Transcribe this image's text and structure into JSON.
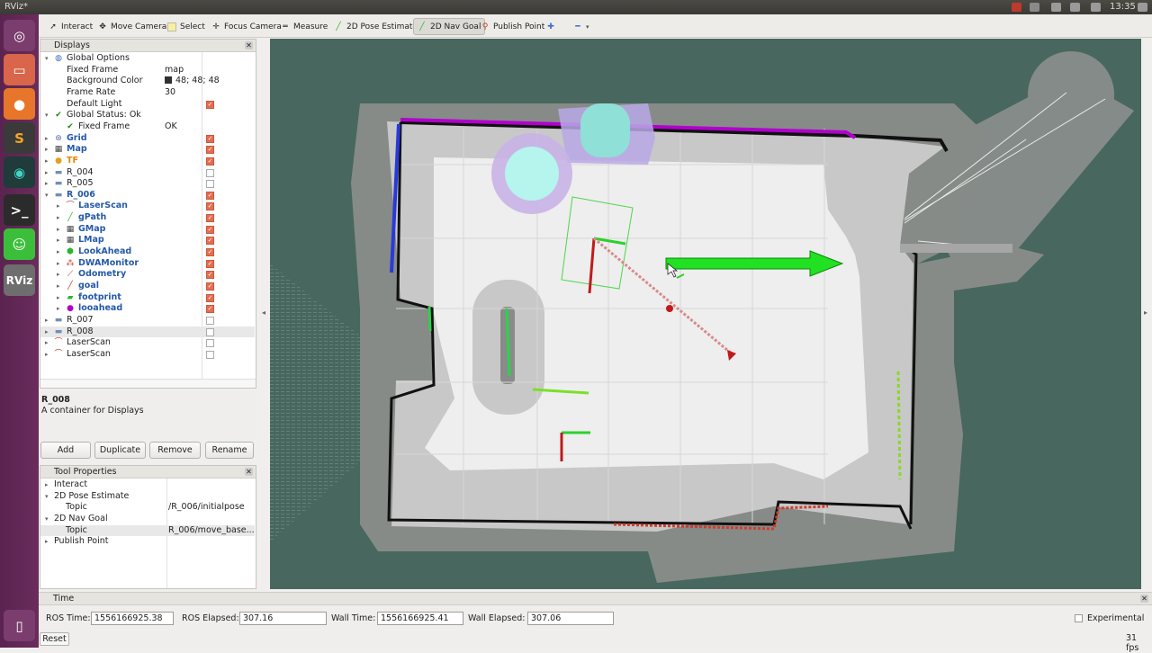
{
  "window": {
    "title": "RViz*",
    "clock": "13:35",
    "fps": "31 fps"
  },
  "launcher": [
    "ubuntu-icon",
    "files-icon",
    "firefox-icon",
    "sublime-icon",
    "gitkraken-icon",
    "terminal-icon",
    "runner-icon",
    "rviz-icon",
    "trash-icon"
  ],
  "toolbar": {
    "tools": [
      {
        "label": "Interact",
        "icon": "cursor-icon"
      },
      {
        "label": "Move Camera",
        "icon": "move-camera-icon"
      },
      {
        "label": "Select",
        "icon": "select-icon"
      },
      {
        "label": "Focus Camera",
        "icon": "focus-camera-icon"
      },
      {
        "label": "Measure",
        "icon": "ruler-icon"
      },
      {
        "label": "2D Pose Estimate",
        "icon": "green-arrow-icon"
      },
      {
        "label": "2D Nav Goal",
        "icon": "green-arrow-icon"
      },
      {
        "label": "Publish Point",
        "icon": "map-pin-icon"
      }
    ],
    "active_tool": "2D Nav Goal"
  },
  "displays": {
    "header": "Displays",
    "rows": [
      {
        "label": "Global Options",
        "indent": 1,
        "expand": "▾",
        "icon": "globe"
      },
      {
        "label": "Fixed Frame",
        "indent": 2,
        "value": "map"
      },
      {
        "label": "Background Color",
        "indent": 2,
        "value": "48; 48; 48",
        "swatch": "#303030"
      },
      {
        "label": "Frame Rate",
        "indent": 2,
        "value": "30"
      },
      {
        "label": "Default Light",
        "indent": 2,
        "check": true
      },
      {
        "label": "Global Status: Ok",
        "indent": 1,
        "expand": "▾",
        "icon": "check"
      },
      {
        "label": "Fixed Frame",
        "indent": 2,
        "icon": "check",
        "value": "OK"
      },
      {
        "label": "Grid",
        "indent": 1,
        "expand": "▸",
        "icon": "grid",
        "style": "blue",
        "check": true
      },
      {
        "label": "Map",
        "indent": 1,
        "expand": "▸",
        "icon": "map",
        "style": "blue",
        "check": true
      },
      {
        "label": "TF",
        "indent": 1,
        "expand": "▸",
        "icon": "tf",
        "style": "orange",
        "check": true
      },
      {
        "label": "R_004",
        "indent": 1,
        "expand": "▸",
        "icon": "folder",
        "check": false
      },
      {
        "label": "R_005",
        "indent": 1,
        "expand": "▸",
        "icon": "folder",
        "check": false
      },
      {
        "label": "R_006",
        "indent": 1,
        "expand": "▾",
        "icon": "folder",
        "style": "blue",
        "check": true
      },
      {
        "label": "LaserScan",
        "indent": 2,
        "expand": "▸",
        "icon": "laser",
        "style": "blue",
        "check": true
      },
      {
        "label": "gPath",
        "indent": 2,
        "expand": "▸",
        "icon": "path",
        "style": "blue",
        "check": true
      },
      {
        "label": "GMap",
        "indent": 2,
        "expand": "▸",
        "icon": "map",
        "style": "blue",
        "check": true
      },
      {
        "label": "LMap",
        "indent": 2,
        "expand": "▸",
        "icon": "map",
        "style": "blue",
        "check": true
      },
      {
        "label": "LookAhead",
        "indent": 2,
        "expand": "▸",
        "icon": "shield",
        "style": "blue",
        "check": true
      },
      {
        "label": "DWAMonitor",
        "indent": 2,
        "expand": "▸",
        "icon": "markers",
        "style": "blue",
        "check": true
      },
      {
        "label": "Odometry",
        "indent": 2,
        "expand": "▸",
        "icon": "odom",
        "style": "blue",
        "check": true
      },
      {
        "label": "goal",
        "indent": 2,
        "expand": "▸",
        "icon": "pose",
        "style": "blue",
        "check": true
      },
      {
        "label": "footprint",
        "indent": 2,
        "expand": "▸",
        "icon": "polygon",
        "style": "blue",
        "check": true
      },
      {
        "label": "looahead",
        "indent": 2,
        "expand": "▸",
        "icon": "dot",
        "style": "blue",
        "check": true
      },
      {
        "label": "R_007",
        "indent": 1,
        "expand": "▸",
        "icon": "folder",
        "check": false
      },
      {
        "label": "R_008",
        "indent": 1,
        "expand": "▸",
        "icon": "folder",
        "check": false,
        "selected": true
      },
      {
        "label": "LaserScan",
        "indent": 1,
        "expand": "▸",
        "icon": "laser",
        "check": false
      },
      {
        "label": "LaserScan",
        "indent": 1,
        "expand": "▸",
        "icon": "laser",
        "check": false
      }
    ],
    "description_title": "R_008",
    "description_text": "A container for Displays",
    "buttons": [
      "Add",
      "Duplicate",
      "Remove",
      "Rename"
    ]
  },
  "tool_properties": {
    "header": "Tool Properties",
    "rows": [
      {
        "label": "Interact",
        "indent": 1,
        "expand": "▸"
      },
      {
        "label": "2D Pose Estimate",
        "indent": 1,
        "expand": "▾"
      },
      {
        "label": "Topic",
        "indent": 2,
        "value": "/R_006/initialpose"
      },
      {
        "label": "2D Nav Goal",
        "indent": 1,
        "expand": "▾"
      },
      {
        "label": "Topic",
        "indent": 2,
        "value": "R_006/move_base...",
        "selected": true
      },
      {
        "label": "Publish Point",
        "indent": 1,
        "expand": "▸"
      }
    ]
  },
  "time": {
    "header": "Time",
    "ros_time_label": "ROS Time:",
    "ros_time": "1556166925.38",
    "ros_elapsed_label": "ROS Elapsed:",
    "ros_elapsed": "307.16",
    "wall_time_label": "Wall Time:",
    "wall_time": "1556166925.41",
    "wall_elapsed_label": "Wall Elapsed:",
    "wall_elapsed": "307.06",
    "experimental_label": "Experimental",
    "reset_label": "Reset"
  },
  "colors": {
    "map_background": "#48675e",
    "checked": "#e56d4f",
    "accent_blue": "#2459a8",
    "goal_arrow": "#1ee01e"
  }
}
